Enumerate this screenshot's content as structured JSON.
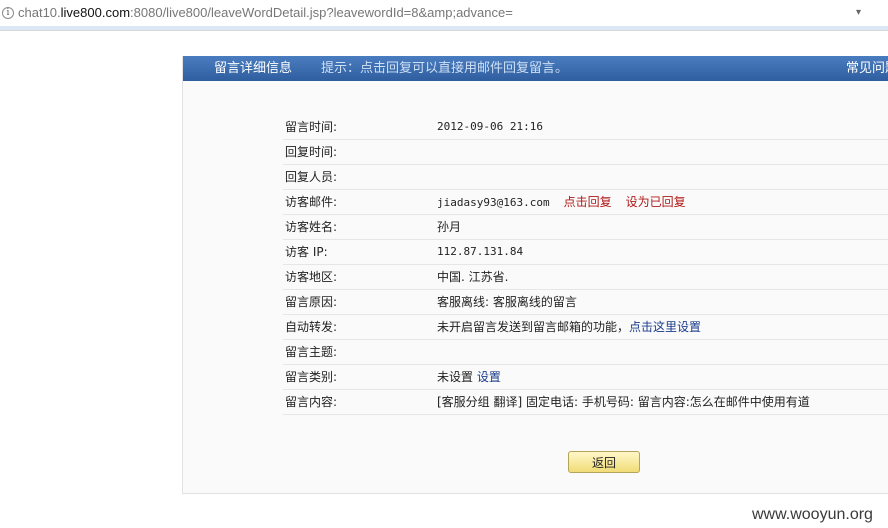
{
  "browser": {
    "page_icon": "i",
    "url_pre": "chat10.",
    "url_domain": "live800.com",
    "url_rest": ":8080/live800/leaveWordDetail.jsp?leavewordId=8&amp;advance="
  },
  "panel": {
    "tab_title": "留言详细信息",
    "hint": "提示：点击回复可以直接用邮件回复留言。",
    "faq": "常见问题"
  },
  "details": {
    "time": {
      "label": "留言时间:",
      "value": "2012-09-06 21:16"
    },
    "reply_time": {
      "label": "回复时间:",
      "value": ""
    },
    "reply_by": {
      "label": "回复人员:",
      "value": ""
    },
    "email": {
      "label": "访客邮件:",
      "value": "jiadasy93@163.com",
      "reply": "点击回复",
      "mark": "设为已回复"
    },
    "name": {
      "label": "访客姓名:",
      "value": "孙月"
    },
    "ip": {
      "label": "访客 IP:",
      "value": "112.87.131.84"
    },
    "region": {
      "label": "访客地区:",
      "value": "中国. 江苏省."
    },
    "reason": {
      "label": "留言原因:",
      "value": "客服离线:  客服离线的留言"
    },
    "forward": {
      "label": "自动转发:",
      "value": "未开启留言发送到留言邮箱的功能，",
      "link": "点击这里设置"
    },
    "subject": {
      "label": "留言主题:",
      "value": ""
    },
    "category": {
      "label": "留言类别:",
      "value": "未设置",
      "link": "设置"
    },
    "content": {
      "label": "留言内容:",
      "value": "[客服分组 翻译] 固定电话: 手机号码: 留言内容:怎么在邮件中使用有道"
    }
  },
  "actions": {
    "back": "返回"
  },
  "watermark": "www.wooyun.org"
}
